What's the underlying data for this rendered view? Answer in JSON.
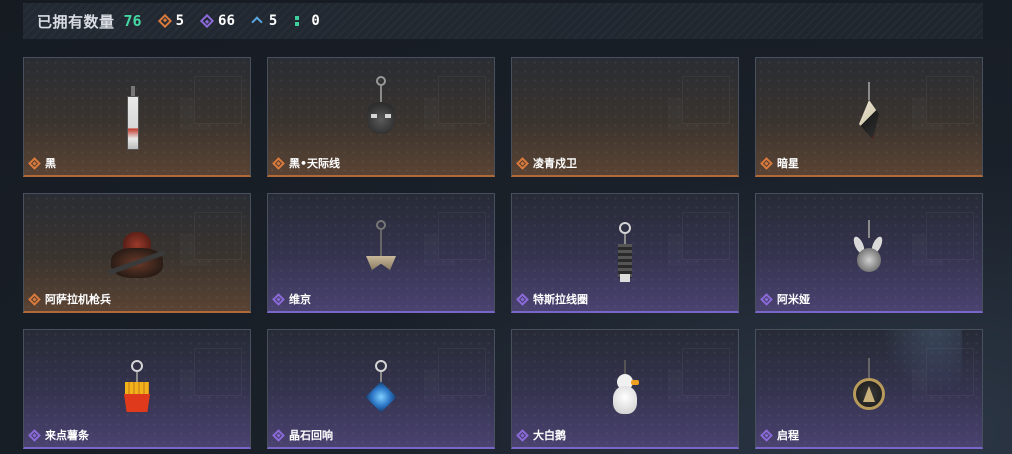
{
  "summary": {
    "owned_label": "已拥有数量",
    "owned_count": "76",
    "stats": [
      {
        "icon": "orange-diamond-icon",
        "value": "5",
        "color": "#d97a3c"
      },
      {
        "icon": "purple-diamond-icon",
        "value": "66",
        "color": "#8a6ad8"
      },
      {
        "icon": "blue-chevron-icon",
        "value": "5",
        "color": "#5aa6e0"
      },
      {
        "icon": "green-dots-icon",
        "value": "0",
        "color": "#3dcf9c"
      }
    ]
  },
  "items": [
    {
      "name": "黑",
      "rarity": "orange",
      "charm": "red-black-tag"
    },
    {
      "name": "黑•天际线",
      "rarity": "orange",
      "charm": "dark-head"
    },
    {
      "name": "凌青戍卫",
      "rarity": "orange",
      "charm": "none"
    },
    {
      "name": "暗星",
      "rarity": "orange",
      "charm": "dark-blade"
    },
    {
      "name": "阿萨拉机枪兵",
      "rarity": "orange",
      "charm": "gunner-figure"
    },
    {
      "name": "维京",
      "rarity": "purple",
      "charm": "axe"
    },
    {
      "name": "特斯拉线圈",
      "rarity": "purple",
      "charm": "tesla-coil"
    },
    {
      "name": "阿米娅",
      "rarity": "purple",
      "charm": "bunny-head"
    },
    {
      "name": "来点薯条",
      "rarity": "purple",
      "charm": "fries"
    },
    {
      "name": "晶石回响",
      "rarity": "purple",
      "charm": "blue-crystal"
    },
    {
      "name": "大白鹅",
      "rarity": "purple",
      "charm": "white-goose"
    },
    {
      "name": "启程",
      "rarity": "purple",
      "charm": "round-medallion"
    }
  ],
  "colors": {
    "orange_accent": "#d97a3c",
    "purple_accent": "#8a6ad8",
    "count_green": "#46d6a3"
  }
}
